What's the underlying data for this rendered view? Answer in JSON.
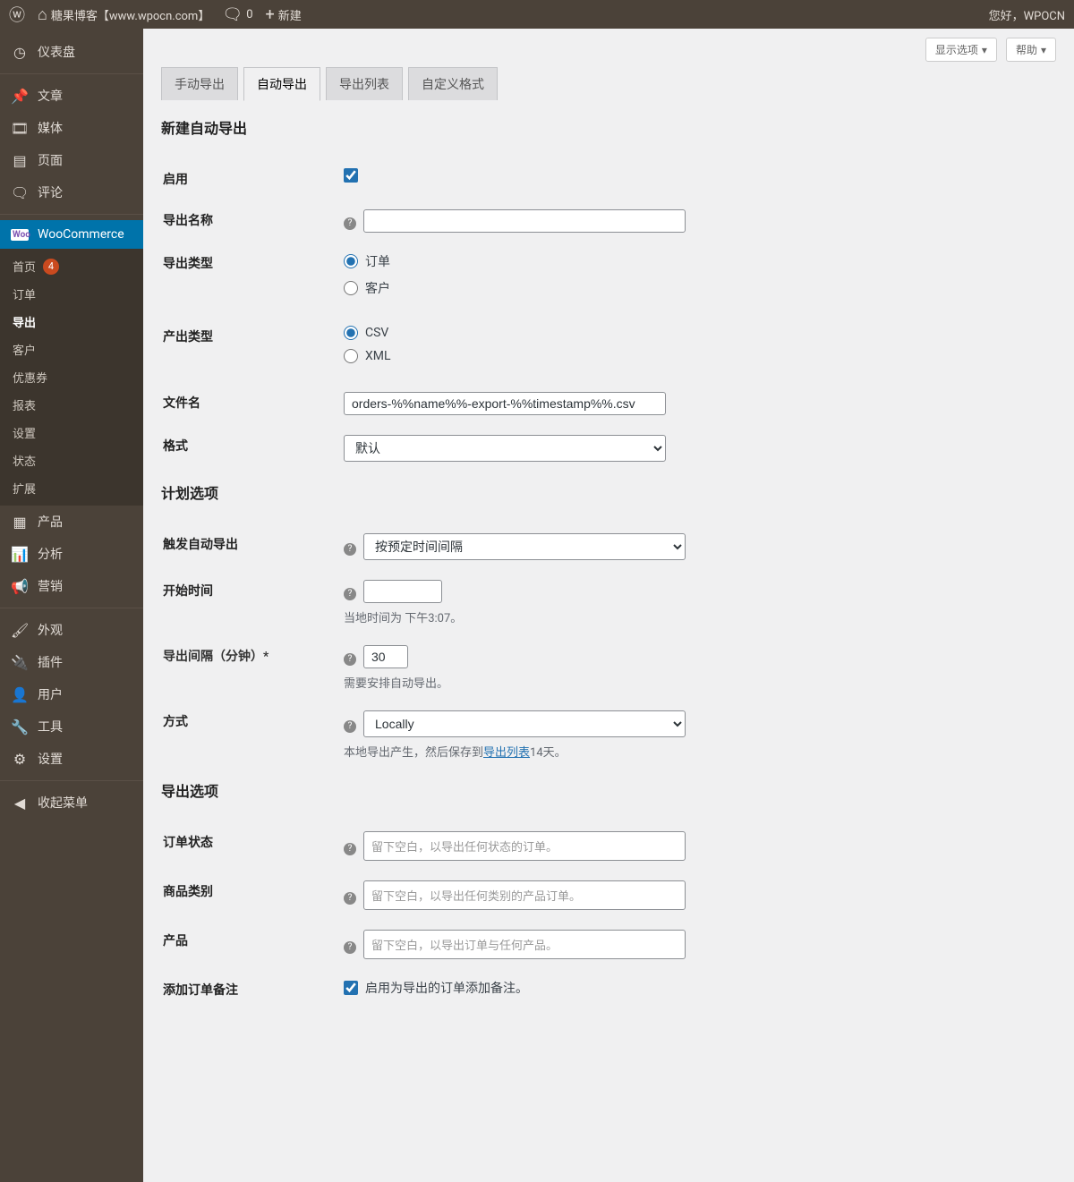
{
  "adminbar": {
    "site": "糖果博客【www.wpocn.com】",
    "comments": "0",
    "new": "新建",
    "greeting": "您好，WPOCN"
  },
  "sidemenu": {
    "dashboard": "仪表盘",
    "posts": "文章",
    "media": "媒体",
    "pages": "页面",
    "comments": "评论",
    "woocommerce": "WooCommerce",
    "woo_sub": {
      "home": "首页",
      "home_badge": "4",
      "orders": "订单",
      "export": "导出",
      "customers": "客户",
      "coupons": "优惠券",
      "reports": "报表",
      "settings": "设置",
      "status": "状态",
      "extensions": "扩展"
    },
    "products": "产品",
    "analytics": "分析",
    "marketing": "营销",
    "appearance": "外观",
    "plugins": "插件",
    "users": "用户",
    "tools": "工具",
    "settings2": "设置",
    "collapse": "收起菜单"
  },
  "top": {
    "screen_options": "显示选项",
    "help": "帮助"
  },
  "tabs": {
    "manual": "手动导出",
    "auto": "自动导出",
    "list": "导出列表",
    "custom": "自定义格式"
  },
  "sections": {
    "new_auto": "新建自动导出",
    "schedule": "计划选项",
    "export_opts": "导出选项"
  },
  "fields": {
    "enable": "启用",
    "export_name": "导出名称",
    "export_type": "导出类型",
    "export_type_orders": "订单",
    "export_type_customers": "客户",
    "output_type": "产出类型",
    "output_csv": "CSV",
    "output_xml": "XML",
    "filename": "文件名",
    "filename_val": "orders-%%name%%-export-%%timestamp%%.csv",
    "format": "格式",
    "format_val": "默认",
    "trigger": "触发自动导出",
    "trigger_val": "按预定时间间隔",
    "start_time": "开始时间",
    "start_time_desc": "当地时间为 下午3:07。",
    "interval": "导出间隔（分钟）*",
    "interval_val": "30",
    "interval_desc": "需要安排自动导出。",
    "method": "方式",
    "method_val": "Locally",
    "method_desc_a": "本地导出产生，然后保存到",
    "method_desc_link": "导出列表",
    "method_desc_b": "14天。",
    "order_status": "订单状态",
    "order_status_ph": "留下空白，以导出任何状态的订单。",
    "prod_cat": "商品类别",
    "prod_cat_ph": "留下空白，以导出任何类别的产品订单。",
    "product": "产品",
    "product_ph": "留下空白，以导出订单与任何产品。",
    "add_notes": "添加订单备注",
    "add_notes_label": "启用为导出的订单添加备注。"
  }
}
